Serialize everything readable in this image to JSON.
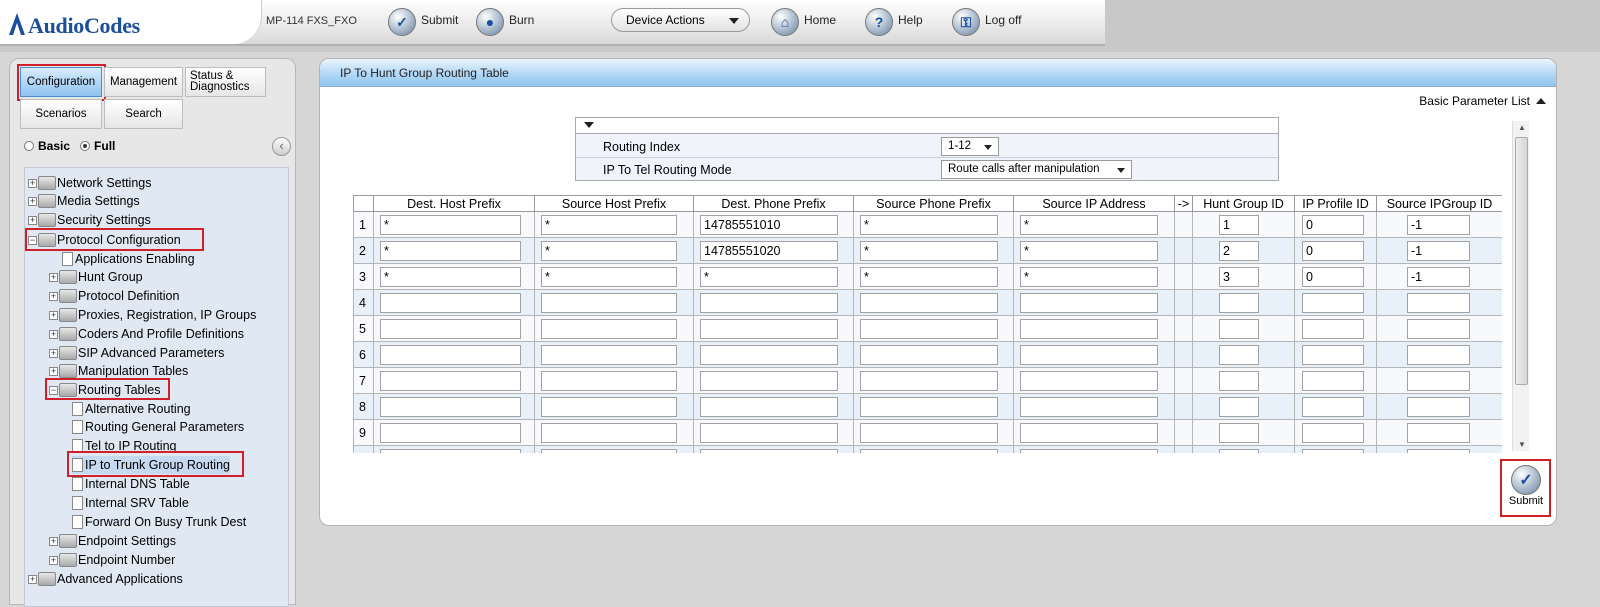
{
  "header": {
    "brand": "AudioCodes",
    "device": "MP-114 FXS_FXO",
    "submit_label": "Submit",
    "burn_label": "Burn",
    "device_actions_label": "Device Actions",
    "home_label": "Home",
    "help_label": "Help",
    "logoff_label": "Log off"
  },
  "menu_tabs": {
    "configuration": "Configuration",
    "management": "Management",
    "status": "Status & Diagnostics",
    "scenarios": "Scenarios",
    "search": "Search"
  },
  "mode": {
    "basic": "Basic",
    "full": "Full",
    "selected": "Full"
  },
  "tree": {
    "network_settings": "Network Settings",
    "media_settings": "Media Settings",
    "security_settings": "Security Settings",
    "protocol_configuration": "Protocol Configuration",
    "applications_enabling": "Applications Enabling",
    "hunt_group": "Hunt Group",
    "protocol_definition": "Protocol Definition",
    "proxies": "Proxies, Registration, IP Groups",
    "coders": "Coders And Profile Definitions",
    "sip_advanced": "SIP Advanced Parameters",
    "manipulation": "Manipulation Tables",
    "routing_tables": "Routing Tables",
    "alternative_routing": "Alternative Routing",
    "routing_general": "Routing General Parameters",
    "tel_to_ip": "Tel to IP Routing",
    "ip_to_trunk": "IP to Trunk Group Routing",
    "internal_dns": "Internal DNS Table",
    "internal_srv": "Internal SRV Table",
    "forward_busy": "Forward On Busy Trunk Dest",
    "endpoint_settings": "Endpoint Settings",
    "endpoint_number": "Endpoint Number",
    "advanced_applications": "Advanced Applications"
  },
  "panel": {
    "title": "IP To Hunt Group Routing Table",
    "basic_param_list": "Basic Parameter List",
    "routing_index_label": "Routing Index",
    "routing_index_value": "1-12",
    "routing_mode_label": "IP To Tel Routing Mode",
    "routing_mode_value": "Route calls after manipulation",
    "submit_label": "Submit"
  },
  "table": {
    "columns": [
      "",
      "Dest. Host Prefix",
      "Source Host Prefix",
      "Dest. Phone Prefix",
      "Source Phone Prefix",
      "Source IP Address",
      "->",
      "Hunt Group ID",
      "IP Profile ID",
      "Source IPGroup ID"
    ],
    "rows": [
      {
        "index": "1",
        "dest_host": "*",
        "src_host": "*",
        "dest_phone": "14785551010",
        "src_phone": "*",
        "src_ip": "*",
        "hunt_group": "1",
        "ip_profile": "0",
        "src_ipgroup": "-1"
      },
      {
        "index": "2",
        "dest_host": "*",
        "src_host": "*",
        "dest_phone": "14785551020",
        "src_phone": "*",
        "src_ip": "*",
        "hunt_group": "2",
        "ip_profile": "0",
        "src_ipgroup": "-1"
      },
      {
        "index": "3",
        "dest_host": "*",
        "src_host": "*",
        "dest_phone": "*",
        "src_phone": "*",
        "src_ip": "*",
        "hunt_group": "3",
        "ip_profile": "0",
        "src_ipgroup": "-1"
      },
      {
        "index": "4",
        "dest_host": "",
        "src_host": "",
        "dest_phone": "",
        "src_phone": "",
        "src_ip": "",
        "hunt_group": "",
        "ip_profile": "",
        "src_ipgroup": ""
      },
      {
        "index": "5",
        "dest_host": "",
        "src_host": "",
        "dest_phone": "",
        "src_phone": "",
        "src_ip": "",
        "hunt_group": "",
        "ip_profile": "",
        "src_ipgroup": ""
      },
      {
        "index": "6",
        "dest_host": "",
        "src_host": "",
        "dest_phone": "",
        "src_phone": "",
        "src_ip": "",
        "hunt_group": "",
        "ip_profile": "",
        "src_ipgroup": ""
      },
      {
        "index": "7",
        "dest_host": "",
        "src_host": "",
        "dest_phone": "",
        "src_phone": "",
        "src_ip": "",
        "hunt_group": "",
        "ip_profile": "",
        "src_ipgroup": ""
      },
      {
        "index": "8",
        "dest_host": "",
        "src_host": "",
        "dest_phone": "",
        "src_phone": "",
        "src_ip": "",
        "hunt_group": "",
        "ip_profile": "",
        "src_ipgroup": ""
      },
      {
        "index": "9",
        "dest_host": "",
        "src_host": "",
        "dest_phone": "",
        "src_phone": "",
        "src_ip": "",
        "hunt_group": "",
        "ip_profile": "",
        "src_ipgroup": ""
      },
      {
        "index": "",
        "dest_host": "",
        "src_host": "",
        "dest_phone": "",
        "src_phone": "",
        "src_ip": "",
        "hunt_group": "",
        "ip_profile": "",
        "src_ipgroup": ""
      }
    ]
  },
  "colors": {
    "brand": "#1b4f9c",
    "highlight": "#d0202a",
    "title_bar": "#b3d8f5"
  }
}
